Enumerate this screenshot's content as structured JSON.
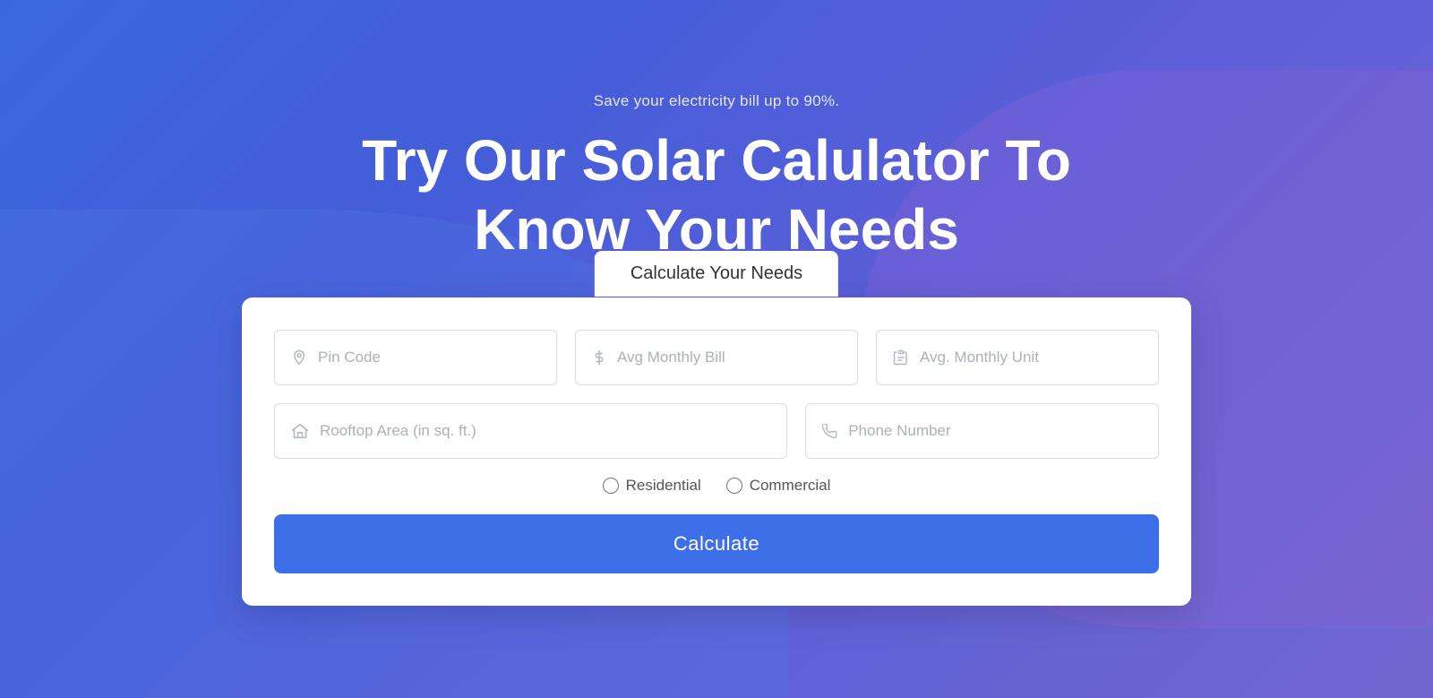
{
  "hero": {
    "subtitle": "Save your electricity bill up to 90%.",
    "main_title": "Try Our Solar Calulator To Know Your Needs"
  },
  "tab": {
    "label": "Calculate Your Needs"
  },
  "form": {
    "fields": {
      "pin_code": {
        "placeholder": "Pin Code",
        "icon": "📍"
      },
      "avg_monthly_bill": {
        "placeholder": "Avg Monthly Bill",
        "icon": "$"
      },
      "avg_monthly_unit": {
        "placeholder": "Avg. Monthly Unit",
        "icon": "📋"
      },
      "rooftop_area": {
        "placeholder": "Rooftop Area (in sq. ft.)",
        "icon": "🏠"
      },
      "phone_number": {
        "placeholder": "Phone Number",
        "icon": "📞"
      }
    },
    "radio_options": [
      {
        "label": "Residential",
        "value": "residential"
      },
      {
        "label": "Commercial",
        "value": "commercial"
      }
    ],
    "calculate_button": "Calculate"
  }
}
